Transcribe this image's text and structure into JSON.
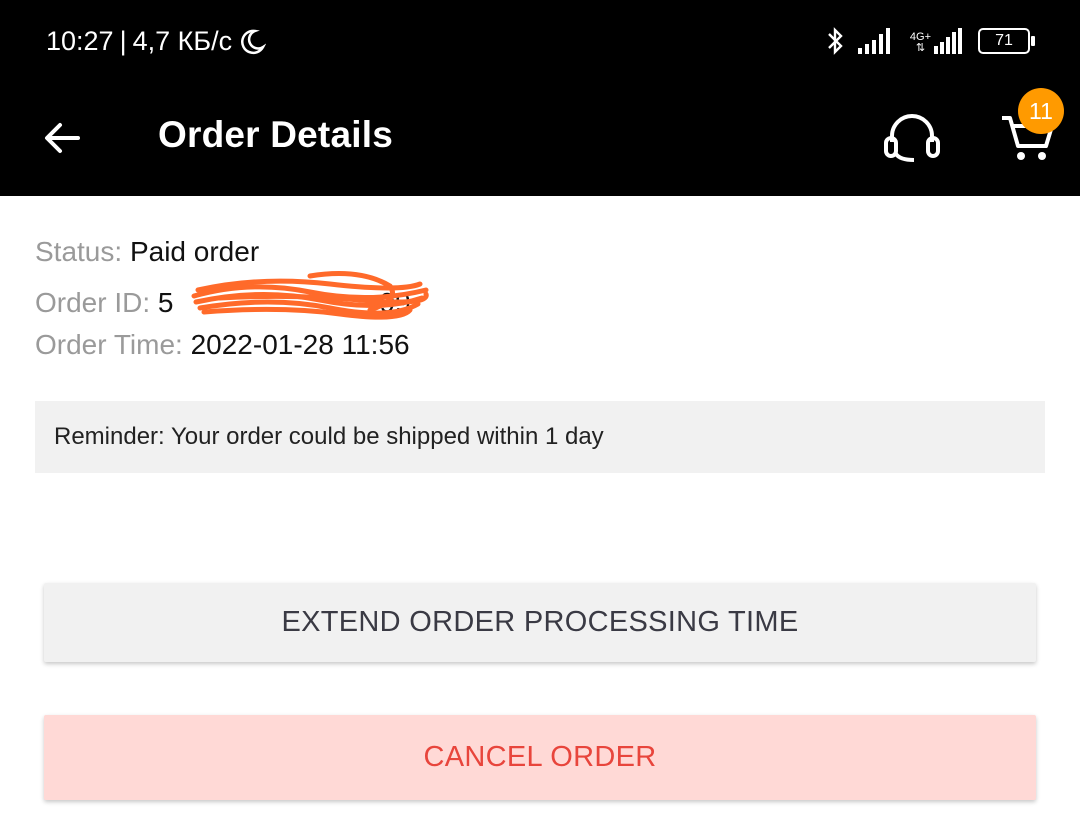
{
  "status_bar": {
    "time": "10:27",
    "separator": "|",
    "speed": "4,7 КБ/с",
    "network": "4G+",
    "battery": "71"
  },
  "app_bar": {
    "title": "Order Details",
    "cart_badge": "11"
  },
  "order": {
    "status_label": "Status:",
    "status_value": "Paid order",
    "id_label": "Order ID:",
    "id_visible_start": "5",
    "id_visible_end": "99",
    "time_label": "Order Time:",
    "time_value": "2022-01-28 11:56"
  },
  "reminder": "Reminder: Your order could be shipped within 1 day",
  "buttons": {
    "extend": "EXTEND ORDER PROCESSING TIME",
    "cancel": "CANCEL ORDER"
  },
  "colors": {
    "accent_badge": "#ff9a00",
    "cancel_text": "#e8453c",
    "cancel_bg": "#ffd9d6",
    "redaction": "#ff6a2a"
  }
}
